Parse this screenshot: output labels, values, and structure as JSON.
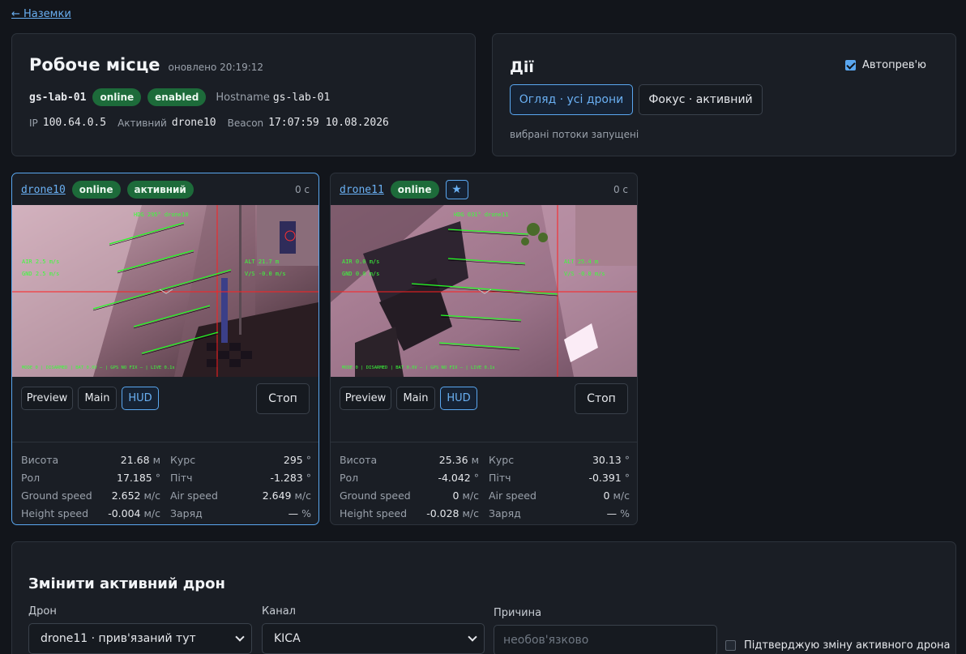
{
  "nav": {
    "back_label": "← Наземки"
  },
  "workplace": {
    "title": "Робоче місце",
    "updated_label": "оновлено",
    "updated_time": "20:19:12",
    "station_name": "gs-lab-01",
    "status_badges": [
      "online",
      "enabled"
    ],
    "hostname_label": "Hostname",
    "hostname": "gs-lab-01",
    "ip_label": "IP",
    "ip": "100.64.0.5",
    "active_label": "Активний",
    "active_drone": "drone10",
    "beacon_label": "Beacon",
    "beacon": "17:07:59 10.08.2026"
  },
  "actions": {
    "title": "Дії",
    "autopreview_label": "Автопрев'ю",
    "autopreview_checked": true,
    "overview_button": "Огляд · усі дрони",
    "focus_button": "Фокус · активний",
    "status_text": "вибрані потоки запущені"
  },
  "drones": [
    {
      "name": "drone10",
      "status": "online",
      "active_badge": "активний",
      "age": "0 с",
      "buttons": {
        "preview": "Preview",
        "main": "Main",
        "hud": "HUD",
        "stop": "Стоп"
      },
      "hud": {
        "heading": "HDG 295°  drone10",
        "air": "AIR 2.5 m/s",
        "gnd": "GND 2.5 m/s",
        "alt": "ALT 21.7 m",
        "vs": "V/S -0.0 m/s",
        "status_line": "MODE 0 | DISARMED | BAT 0.0V — | GPS NO FIX — | LIVE 0.1s"
      },
      "telemetry": [
        {
          "label": "Висота",
          "value": "21.68",
          "unit": "м"
        },
        {
          "label": "Курс",
          "value": "295",
          "unit": "°"
        },
        {
          "label": "Рол",
          "value": "17.185",
          "unit": "°"
        },
        {
          "label": "Пітч",
          "value": "-1.283",
          "unit": "°"
        },
        {
          "label": "Ground speed",
          "value": "2.652",
          "unit": "м/с"
        },
        {
          "label": "Air speed",
          "value": "2.649",
          "unit": "м/с"
        },
        {
          "label": "Height speed",
          "value": "-0.004",
          "unit": "м/с"
        },
        {
          "label": "Заряд",
          "value": "—",
          "unit": "%"
        }
      ]
    },
    {
      "name": "drone11",
      "status": "online",
      "star_icon": "★",
      "age": "0 с",
      "buttons": {
        "preview": "Preview",
        "main": "Main",
        "hud": "HUD",
        "stop": "Стоп"
      },
      "hud": {
        "heading": "HDG 031°  drone11",
        "air": "AIR 0.0 m/s",
        "gnd": "GND 0.0 m/s",
        "alt": "ALT 25.4 m",
        "vs": "V/S -0.0 m/s",
        "status_line": "MODE 0 | DISARMED | BAT 0.0V — | GPS NO FIX — | LIVE 0.1s"
      },
      "telemetry": [
        {
          "label": "Висота",
          "value": "25.36",
          "unit": "м"
        },
        {
          "label": "Курс",
          "value": "30.13",
          "unit": "°"
        },
        {
          "label": "Рол",
          "value": "-4.042",
          "unit": "°"
        },
        {
          "label": "Пітч",
          "value": "-0.391",
          "unit": "°"
        },
        {
          "label": "Ground speed",
          "value": "0",
          "unit": "м/с"
        },
        {
          "label": "Air speed",
          "value": "0",
          "unit": "м/с"
        },
        {
          "label": "Height speed",
          "value": "-0.028",
          "unit": "м/с"
        },
        {
          "label": "Заряд",
          "value": "—",
          "unit": "%"
        }
      ]
    }
  ],
  "change_active": {
    "title": "Змінити активний дрон",
    "drone_label": "Дрон",
    "drone_value": "drone11 · прив'язаний тут",
    "channel_label": "Канал",
    "channel_value": "KICA",
    "reason_label": "Причина",
    "reason_placeholder": "необов'язково",
    "confirm_label": "Підтверджую зміну активного дрона",
    "confirm_checked": false
  },
  "colors": {
    "accent": "#5aa7f0",
    "badge_green": "#1d6b3a",
    "background": "#12151b",
    "panel": "#1a1e25",
    "hud_green": "#3aff3a"
  }
}
